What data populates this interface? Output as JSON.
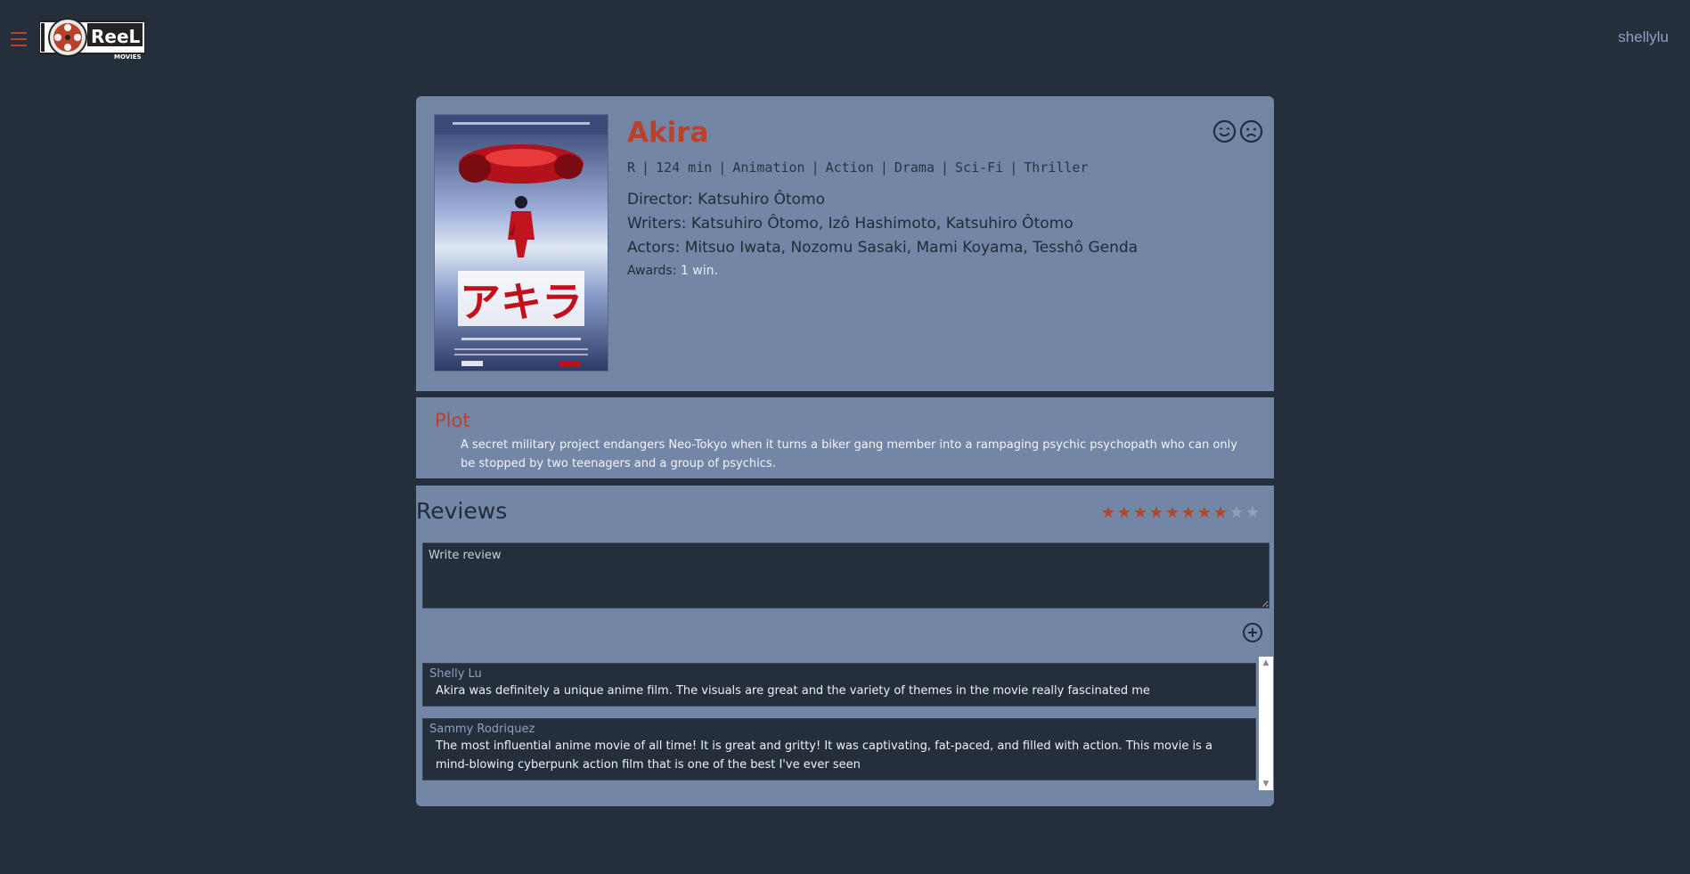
{
  "header": {
    "menu_icon": "hamburger-icon",
    "logo_text": "ReeL",
    "logo_subtext": "MOVIES",
    "username": "shellylu",
    "accent_color": "#b8432a"
  },
  "movie": {
    "title": "Akira",
    "meta": [
      "R",
      "124 min",
      "Animation",
      "Action",
      "Drama",
      "Sci-Fi",
      "Thriller"
    ],
    "director_label": "Director:",
    "director": "Katsuhiro Ôtomo",
    "writers_label": "Writers:",
    "writers": "Katsuhiro Ôtomo, Izô Hashimoto, Katsuhiro Ôtomo",
    "actors_label": "Actors:",
    "actors": "Mitsuo Iwata, Nozomu Sasaki, Mami Koyama, Tesshô Genda",
    "awards_label": "Awards:",
    "awards": "1 win.",
    "poster_alt": "Akira movie poster",
    "poster_logo": "アキラ",
    "mood_icons": [
      "smile-icon",
      "frown-icon"
    ]
  },
  "plot": {
    "heading": "Plot",
    "text": "A secret military project endangers Neo-Tokyo when it turns a biker gang member into a rampaging psychic psychopath who can only be stopped by two teenagers and a group of psychics."
  },
  "reviews": {
    "heading": "Reviews",
    "rating": 8,
    "rating_max": 10,
    "input_placeholder": "Write review",
    "add_icon": "plus-circle-icon",
    "items": [
      {
        "author": "Shelly Lu",
        "text": "Akira was definitely a unique anime film. The visuals are great and the variety of themes in the movie really fascinated me"
      },
      {
        "author": "Sammy Rodriquez",
        "text": "The most influential anime movie of all time! It is great and gritty! It was captivating, fat-paced, and filled with action. This movie is a mind-blowing cyberpunk action film that is one of the best I've ever seen"
      }
    ]
  }
}
